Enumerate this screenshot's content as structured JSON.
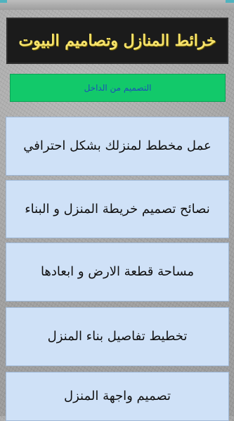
{
  "app": {
    "title": "خرائط المنازل وتصاميم البيوت"
  },
  "tab": {
    "label": "التصميم من الداخل"
  },
  "menu": {
    "items": [
      {
        "label": "عمل مخطط لمنزلك بشكل احترافي"
      },
      {
        "label": "نصائح تصميم خريطة المنزل و البناء"
      },
      {
        "label": "مساحة قطعة الارض و ابعادها"
      },
      {
        "label": "تخطيط تفاصيل بناء المنزل"
      },
      {
        "label": "تصميم واجهة المنزل"
      }
    ]
  },
  "colors": {
    "background": "#a9a9a9",
    "banner_background": "#1b1b1b",
    "banner_text": "#f7e36a",
    "tab_background": "#12c96a",
    "tab_text": "#1d4fb8",
    "item_background": "#cfe1f7",
    "accent_strip": "#4fb3bf"
  }
}
